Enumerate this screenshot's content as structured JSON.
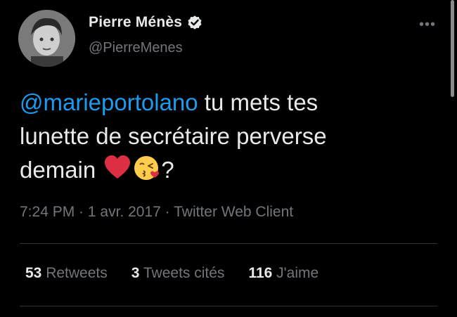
{
  "author": {
    "display_name": "Pierre Ménès",
    "handle": "@PierreMenes",
    "verified": true
  },
  "menu": {
    "more_label": "•••"
  },
  "tweet": {
    "mention": "@marieportolano",
    "text_part1": " tu mets tes",
    "text_line2": "lunette de secrétaire perverse",
    "text_line3": "demain ",
    "text_end": "?",
    "emojis": [
      "red-heart",
      "face-blowing-kiss"
    ]
  },
  "meta": {
    "time": "7:24 PM",
    "sep1": " · ",
    "date": "1 avr. 2017",
    "sep2": " · ",
    "source": "Twitter Web Client"
  },
  "stats": {
    "retweets_count": "53",
    "retweets_label": " Retweets",
    "quotes_count": "3",
    "quotes_label": " Tweets cités",
    "likes_count": "116",
    "likes_label": " J'aime"
  },
  "colors": {
    "background": "#000000",
    "text": "#e7e9ea",
    "secondary": "#71767b",
    "accent": "#1d9bf0",
    "divider": "#2f3336"
  }
}
